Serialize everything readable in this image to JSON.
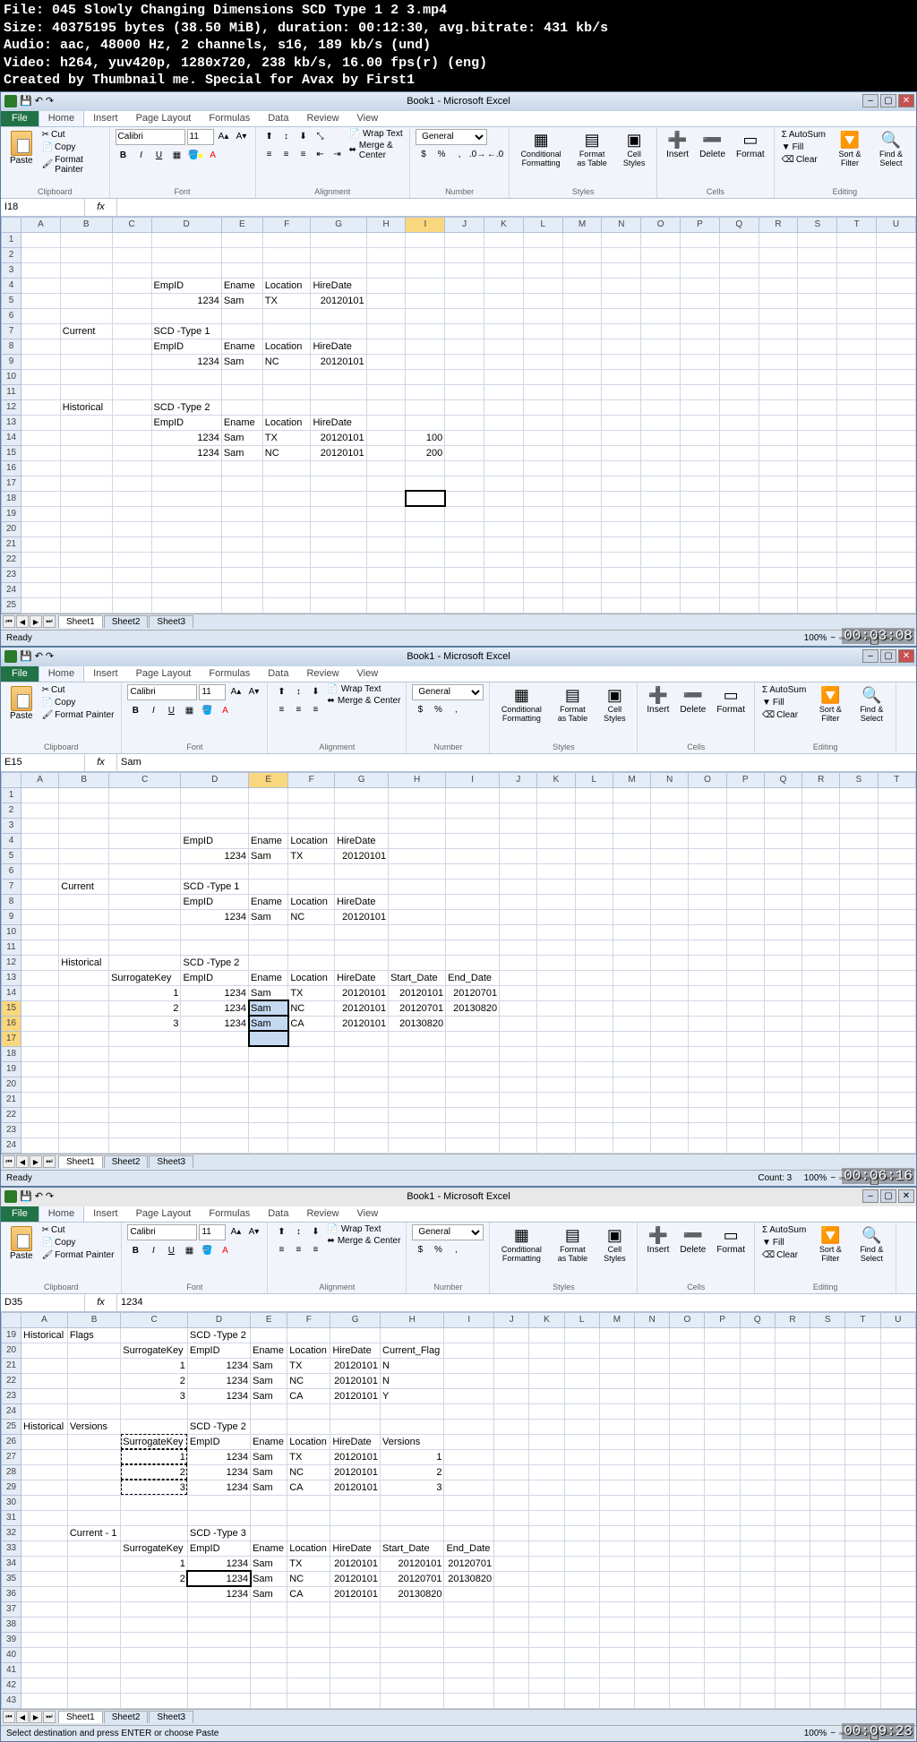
{
  "video_info": {
    "line1": "File: 045 Slowly Changing Dimensions SCD Type 1 2 3.mp4",
    "line2": "Size: 40375195 bytes (38.50 MiB), duration: 00:12:30, avg.bitrate: 431 kb/s",
    "line3": "Audio: aac, 48000 Hz, 2 channels, s16, 189 kb/s (und)",
    "line4": "Video: h264, yuv420p, 1280x720, 238 kb/s, 16.00 fps(r) (eng)",
    "line5": "Created by Thumbnail me. Special for Avax by First1"
  },
  "app_title": "Book1 - Microsoft Excel",
  "ribbon": {
    "file": "File",
    "tabs": [
      "Home",
      "Insert",
      "Page Layout",
      "Formulas",
      "Data",
      "Review",
      "View"
    ],
    "clipboard": {
      "paste": "Paste",
      "cut": "Cut",
      "copy": "Copy",
      "fp": "Format Painter",
      "label": "Clipboard"
    },
    "font": {
      "name": "Calibri",
      "size": "11",
      "label": "Font"
    },
    "alignment": {
      "wrap": "Wrap Text",
      "merge": "Merge & Center",
      "label": "Alignment"
    },
    "number": {
      "format": "General",
      "label": "Number"
    },
    "styles": {
      "cf": "Conditional Formatting",
      "ft": "Format as Table",
      "cs": "Cell Styles",
      "label": "Styles"
    },
    "cells": {
      "ins": "Insert",
      "del": "Delete",
      "fmt": "Format",
      "label": "Cells"
    },
    "editing": {
      "sum": "AutoSum",
      "fill": "Fill",
      "clear": "Clear",
      "sort": "Sort & Filter",
      "find": "Find & Select",
      "label": "Editing"
    }
  },
  "frame1": {
    "namebox": "I18",
    "fx": "",
    "cols": [
      "A",
      "B",
      "C",
      "D",
      "E",
      "F",
      "G",
      "H",
      "I",
      "J",
      "K",
      "L",
      "M",
      "N",
      "O",
      "P",
      "Q",
      "R",
      "S",
      "T",
      "U"
    ],
    "active_col": "I",
    "data": {
      "labels": {
        "empid": "EmpID",
        "ename": "Ename",
        "location": "Location",
        "hiredate": "HireDate"
      },
      "r4": {
        "d": "EmpID",
        "e": "Ename",
        "f": "Location",
        "g": "HireDate"
      },
      "r5": {
        "d": "1234",
        "e": "Sam",
        "f": "TX",
        "g": "20120101"
      },
      "r7": {
        "b": "Current",
        "d": "SCD -Type 1"
      },
      "r8": {
        "d": "EmpID",
        "e": "Ename",
        "f": "Location",
        "g": "HireDate"
      },
      "r9": {
        "d": "1234",
        "e": "Sam",
        "f": "NC",
        "g": "20120101"
      },
      "r12": {
        "b": "Historical",
        "d": "SCD -Type 2"
      },
      "r13": {
        "d": "EmpID",
        "e": "Ename",
        "f": "Location",
        "g": "HireDate"
      },
      "r14": {
        "d": "1234",
        "e": "Sam",
        "f": "TX",
        "g": "20120101",
        "i": "100"
      },
      "r15": {
        "d": "1234",
        "e": "Sam",
        "f": "NC",
        "g": "20120101",
        "i": "200"
      }
    },
    "ts": "00:03:08",
    "status": "Ready",
    "zoom": "100%"
  },
  "frame2": {
    "namebox": "E15",
    "fx": "Sam",
    "cols": [
      "A",
      "B",
      "C",
      "D",
      "E",
      "F",
      "G",
      "H",
      "I",
      "J",
      "K",
      "L",
      "M",
      "N",
      "O",
      "P",
      "Q",
      "R",
      "S",
      "T"
    ],
    "active_col": "E",
    "data": {
      "r4": {
        "d": "EmpID",
        "e": "Ename",
        "f": "Location",
        "g": "HireDate"
      },
      "r5": {
        "d": "1234",
        "e": "Sam",
        "f": "TX",
        "g": "20120101"
      },
      "r7": {
        "b": "Current",
        "d": "SCD -Type 1"
      },
      "r8": {
        "d": "EmpID",
        "e": "Ename",
        "f": "Location",
        "g": "HireDate"
      },
      "r9": {
        "d": "1234",
        "e": "Sam",
        "f": "NC",
        "g": "20120101"
      },
      "r12": {
        "b": "Historical",
        "d": "SCD -Type 2"
      },
      "r13": {
        "c": "SurrogateKey",
        "d": "EmpID",
        "e": "Ename",
        "f": "Location",
        "g": "HireDate",
        "h": "Start_Date",
        "i": "End_Date"
      },
      "r14": {
        "c": "1",
        "d": "1234",
        "e": "Sam",
        "f": "TX",
        "g": "20120101",
        "h": "20120101",
        "i": "20120701"
      },
      "r15": {
        "c": "2",
        "d": "1234",
        "e": "Sam",
        "f": "NC",
        "g": "20120101",
        "h": "20120701",
        "i": "20130820"
      },
      "r16": {
        "c": "3",
        "d": "1234",
        "e": "Sam",
        "f": "CA",
        "g": "20120101",
        "h": "20130820"
      }
    },
    "ts": "00:06:16",
    "status": "Ready",
    "count": "Count: 3",
    "zoom": "100%"
  },
  "frame3": {
    "namebox": "D35",
    "fx": "1234",
    "cols": [
      "A",
      "B",
      "C",
      "D",
      "E",
      "F",
      "G",
      "H",
      "I",
      "J",
      "K",
      "L",
      "M",
      "N",
      "O",
      "P",
      "Q",
      "R",
      "S",
      "T",
      "U"
    ],
    "data": {
      "r19": {
        "a": "Historical",
        "b": "Flags",
        "d": "SCD -Type 2"
      },
      "r20": {
        "c": "SurrogateKey",
        "d": "EmpID",
        "e": "Ename",
        "f": "Location",
        "g": "HireDate",
        "h": "Current_Flag"
      },
      "r21": {
        "c": "1",
        "d": "1234",
        "e": "Sam",
        "f": "TX",
        "g": "20120101",
        "h": "N"
      },
      "r22": {
        "c": "2",
        "d": "1234",
        "e": "Sam",
        "f": "NC",
        "g": "20120101",
        "h": "N"
      },
      "r23": {
        "c": "3",
        "d": "1234",
        "e": "Sam",
        "f": "CA",
        "g": "20120101",
        "h": "Y"
      },
      "r25": {
        "a": "Historical",
        "b": "Versions",
        "d": "SCD -Type 2"
      },
      "r26": {
        "c": "SurrogateKey",
        "d": "EmpID",
        "e": "Ename",
        "f": "Location",
        "g": "HireDate",
        "h": "Versions"
      },
      "r27": {
        "c": "1",
        "d": "1234",
        "e": "Sam",
        "f": "TX",
        "g": "20120101",
        "h": "1"
      },
      "r28": {
        "c": "2",
        "d": "1234",
        "e": "Sam",
        "f": "NC",
        "g": "20120101",
        "h": "2"
      },
      "r29": {
        "c": "3",
        "d": "1234",
        "e": "Sam",
        "f": "CA",
        "g": "20120101",
        "h": "3"
      },
      "r32": {
        "b": "Current - 1",
        "d": "SCD -Type 3"
      },
      "r33": {
        "c": "SurrogateKey",
        "d": "EmpID",
        "e": "Ename",
        "f": "Location",
        "g": "HireDate",
        "h": "Start_Date",
        "i": "End_Date"
      },
      "r34": {
        "c": "1",
        "d": "1234",
        "e": "Sam",
        "f": "TX",
        "g": "20120101",
        "h": "20120101",
        "i": "20120701"
      },
      "r35": {
        "c": "2",
        "d": "1234",
        "e": "Sam",
        "f": "NC",
        "g": "20120101",
        "h": "20120701",
        "i": "20130820"
      },
      "r36": {
        "d": "1234",
        "e": "Sam",
        "f": "CA",
        "g": "20120101",
        "h": "20130820"
      }
    },
    "ts": "00:09:23",
    "status": "Select destination and press ENTER or choose Paste",
    "zoom": "100%"
  },
  "sheets": [
    "Sheet1",
    "Sheet2",
    "Sheet3"
  ]
}
